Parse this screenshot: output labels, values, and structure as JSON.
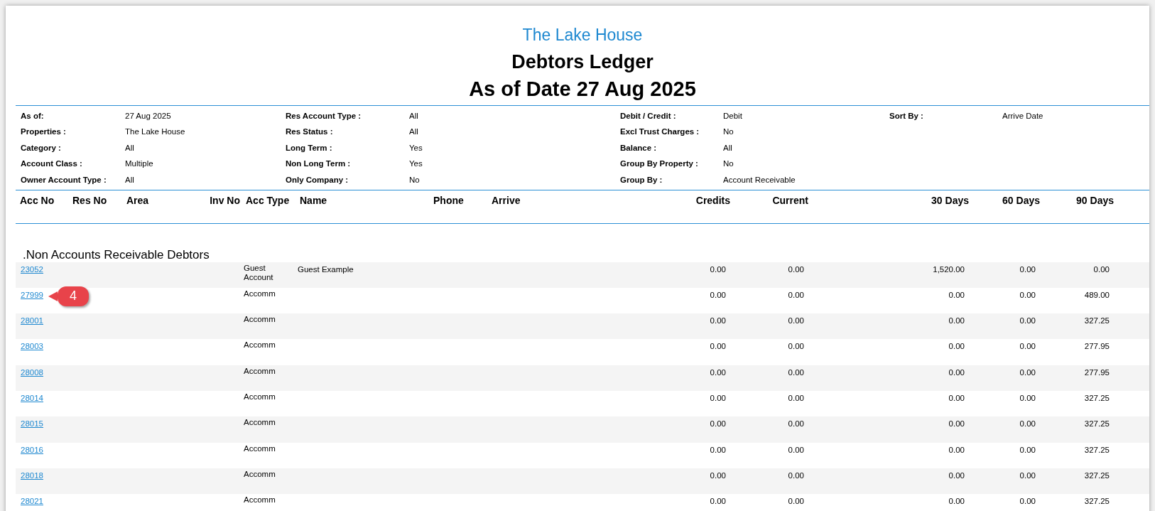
{
  "report": {
    "property": "The Lake House",
    "title": "Debtors Ledger",
    "subtitle": "As of Date 27 Aug 2025"
  },
  "parameters": [
    [
      {
        "label": "As of:",
        "value": "27 Aug 2025"
      },
      {
        "label": "Res Account Type :",
        "value": "All"
      },
      {
        "label": "Debit / Credit :",
        "value": "Debit"
      },
      {
        "label": "Sort By :",
        "value": "Arrive Date"
      }
    ],
    [
      {
        "label": "Properties :",
        "value": "The Lake House"
      },
      {
        "label": "Res Status :",
        "value": "All"
      },
      {
        "label": "Excl Trust Charges :",
        "value": "No"
      }
    ],
    [
      {
        "label": "Category :",
        "value": "All"
      },
      {
        "label": "Long Term :",
        "value": "Yes"
      },
      {
        "label": "Balance :",
        "value": "All"
      }
    ],
    [
      {
        "label": "Account Class :",
        "value": "Multiple"
      },
      {
        "label": "Non Long Term :",
        "value": "Yes"
      },
      {
        "label": "Group By Property :",
        "value": "No"
      }
    ],
    [
      {
        "label": "Owner Account Type :",
        "value": "All"
      },
      {
        "label": "Only Company :",
        "value": "No"
      },
      {
        "label": "Group By :",
        "value": "Account Receivable"
      }
    ]
  ],
  "columns": [
    "Acc No",
    "Res No",
    "Area",
    "Inv No",
    "Acc Type",
    "Name",
    "Phone",
    "Arrive",
    "Credits",
    "Current",
    "30 Days",
    "60 Days",
    "90 Days"
  ],
  "section": ".Non Accounts Receivable Debtors",
  "rows": [
    {
      "acc_no": "23052",
      "acc_type": "Guest Account",
      "name": "Guest Example",
      "credits": "0.00",
      "current": "0.00",
      "days_30": "1,520.00",
      "days_60": "0.00",
      "days_90": "0.00"
    },
    {
      "acc_no": "27999",
      "callout": "4",
      "acc_type": "Accomm",
      "credits": "0.00",
      "current": "0.00",
      "days_30": "0.00",
      "days_60": "0.00",
      "days_90": "489.00"
    },
    {
      "acc_no": "28001",
      "acc_type": "Accomm",
      "credits": "0.00",
      "current": "0.00",
      "days_30": "0.00",
      "days_60": "0.00",
      "days_90": "327.25"
    },
    {
      "acc_no": "28003",
      "acc_type": "Accomm",
      "credits": "0.00",
      "current": "0.00",
      "days_30": "0.00",
      "days_60": "0.00",
      "days_90": "277.95"
    },
    {
      "acc_no": "28008",
      "acc_type": "Accomm",
      "credits": "0.00",
      "current": "0.00",
      "days_30": "0.00",
      "days_60": "0.00",
      "days_90": "277.95"
    },
    {
      "acc_no": "28014",
      "acc_type": "Accomm",
      "credits": "0.00",
      "current": "0.00",
      "days_30": "0.00",
      "days_60": "0.00",
      "days_90": "327.25"
    },
    {
      "acc_no": "28015",
      "acc_type": "Accomm",
      "credits": "0.00",
      "current": "0.00",
      "days_30": "0.00",
      "days_60": "0.00",
      "days_90": "327.25"
    },
    {
      "acc_no": "28016",
      "acc_type": "Accomm",
      "credits": "0.00",
      "current": "0.00",
      "days_30": "0.00",
      "days_60": "0.00",
      "days_90": "327.25"
    },
    {
      "acc_no": "28018",
      "acc_type": "Accomm",
      "credits": "0.00",
      "current": "0.00",
      "days_30": "0.00",
      "days_60": "0.00",
      "days_90": "327.25"
    },
    {
      "acc_no": "28021",
      "acc_type": "Accomm",
      "credits": "0.00",
      "current": "0.00",
      "days_30": "0.00",
      "days_60": "0.00",
      "days_90": "327.25"
    }
  ]
}
